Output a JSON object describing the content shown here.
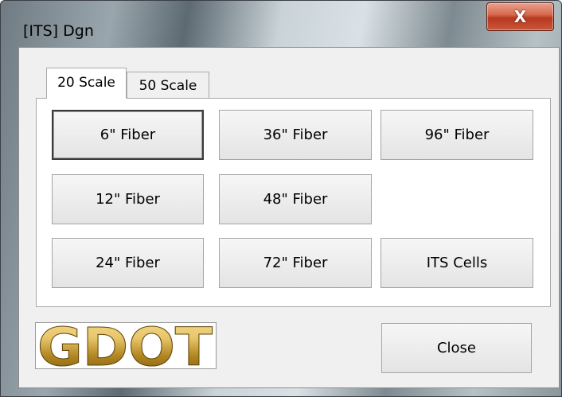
{
  "window": {
    "title": "[ITS] Dgn",
    "close_glyph": "X"
  },
  "tabs": [
    {
      "label": "20 Scale",
      "selected": true
    },
    {
      "label": "50 Scale",
      "selected": false
    }
  ],
  "fiber_buttons": {
    "f6": "6\" Fiber",
    "f12": "12\" Fiber",
    "f24": "24\" Fiber",
    "f36": "36\" Fiber",
    "f48": "48\" Fiber",
    "f72": "72\" Fiber",
    "f96": "96\" Fiber",
    "its_cells": "ITS Cells"
  },
  "footer": {
    "logo_text": "GDOT",
    "close_label": "Close"
  },
  "colors": {
    "logo_gold_light": "#e8c56a",
    "logo_gold_dark": "#7a5a12",
    "close_button_red": "#c9573a"
  }
}
